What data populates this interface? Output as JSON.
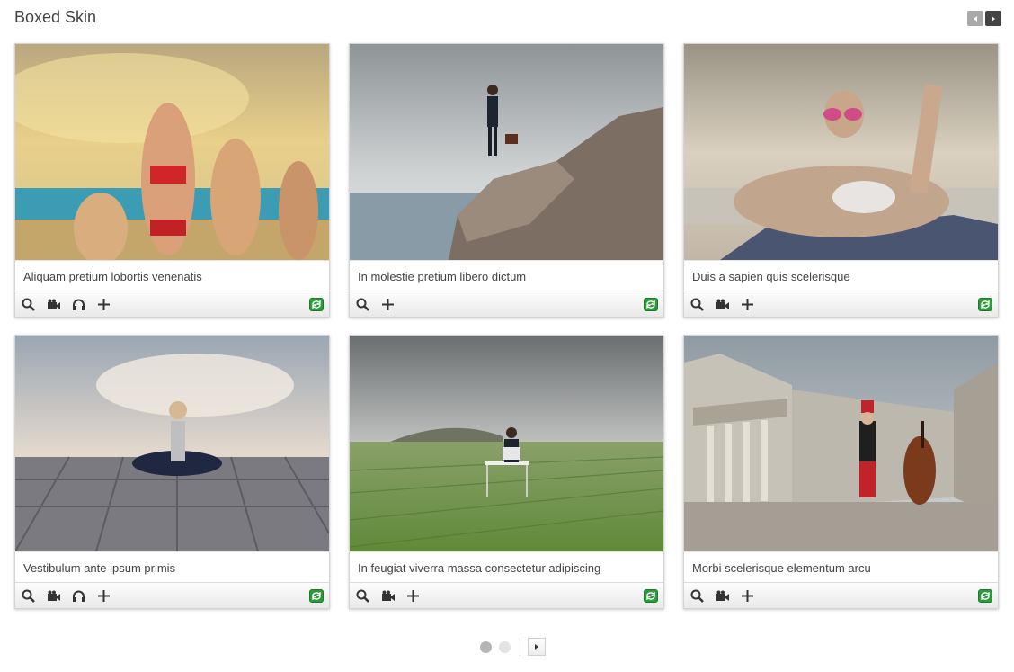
{
  "header": {
    "title": "Boxed Skin"
  },
  "nav": {
    "prev_icon": "arrow-left-icon",
    "next_icon": "arrow-right-icon"
  },
  "cards": [
    {
      "caption": "Aliquam pretium lobortis venenatis",
      "image": "women on beach in bikinis, golden sky",
      "tools": [
        "zoom",
        "video",
        "audio",
        "plus"
      ]
    },
    {
      "caption": "In molestie pretium libero dictum",
      "image": "businessman with binoculars on cliff over sea",
      "tools": [
        "zoom",
        "plus"
      ]
    },
    {
      "caption": "Duis a sapien quis scelerisque",
      "image": "woman with sunglasses lying on rock",
      "tools": [
        "zoom",
        "video",
        "plus"
      ]
    },
    {
      "caption": "Vestibulum ante ipsum primis",
      "image": "woman in yoga pose on wooden deck",
      "tools": [
        "zoom",
        "video",
        "audio",
        "plus"
      ]
    },
    {
      "caption": "In feugiat viverra massa consectetur adipiscing",
      "image": "man at desk with laptop in green field",
      "tools": [
        "zoom",
        "video",
        "plus"
      ]
    },
    {
      "caption": "Morbi scelerisque elementum arcu",
      "image": "musician with cello in front of classical building",
      "tools": [
        "zoom",
        "video",
        "plus"
      ]
    }
  ],
  "pagination": {
    "pages": 2,
    "current": 1
  },
  "colors": {
    "share_green": "#2a9a3a",
    "active_dot": "#b5b5b5",
    "inactive_dot": "#e3e3e3"
  }
}
